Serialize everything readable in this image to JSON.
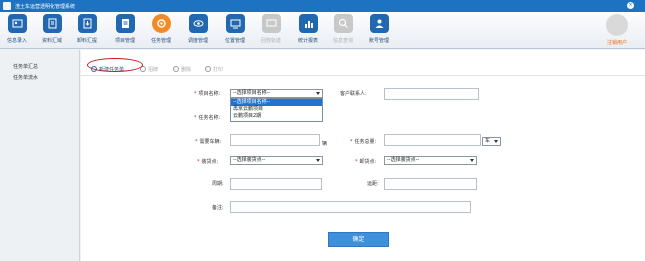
{
  "app": {
    "title": "渣土车运营透明化管理系统",
    "close_symbol": "×"
  },
  "toolbar": {
    "items": [
      {
        "label": "信息录入",
        "icon": "id-card-icon"
      },
      {
        "label": "资料汇域",
        "icon": "pencil-icon"
      },
      {
        "label": "卸料汇提",
        "icon": "download-icon"
      },
      {
        "label": "项目管理",
        "icon": "document-icon"
      },
      {
        "label": "任务管理",
        "icon": "gear-icon"
      },
      {
        "label": "调度管理",
        "icon": "eye-icon"
      },
      {
        "label": "位置管理",
        "icon": "monitor-icon"
      },
      {
        "label": "回放轨迹",
        "icon": "screen-icon"
      },
      {
        "label": "统计报表",
        "icon": "bar-chart-icon"
      },
      {
        "label": "信息查询",
        "icon": "search-icon"
      },
      {
        "label": "账号管理",
        "icon": "user-icon"
      }
    ],
    "logout_label": "注销用户"
  },
  "sidebar": {
    "items": [
      {
        "label": "任务单汇总"
      },
      {
        "label": "任务单流水"
      }
    ]
  },
  "tabs": [
    {
      "label": "新建任务单",
      "selected": true
    },
    {
      "label": "招牌"
    },
    {
      "label": "删除"
    },
    {
      "label": "打印"
    }
  ],
  "form": {
    "project_name": {
      "label": "项目名称:",
      "value": "--选择项目名称--"
    },
    "project_options": [
      "--选择项目名称--",
      "再京云鹏项目",
      "云鹏项目2期"
    ],
    "task_name": {
      "label": "任务名称:"
    },
    "customer_contact": {
      "label": "客户联系人:",
      "value": ""
    },
    "vehicles_needed": {
      "label": "需要车辆:",
      "value": "",
      "unit": "辆"
    },
    "task_total": {
      "label": "任务总量:",
      "value": "",
      "unit_select": "车"
    },
    "loading_point": {
      "label": "装货点:",
      "value": "--选择装货点--"
    },
    "unloading_point": {
      "label": "卸货点:",
      "value": "--选择装货点--"
    },
    "cycle": {
      "label": "周期:",
      "value": ""
    },
    "distance": {
      "label": "运距:",
      "value": ""
    },
    "remark": {
      "label": "备注:",
      "value": ""
    },
    "required_mark": "*"
  },
  "buttons": {
    "confirm_label": "确定"
  },
  "colors": {
    "primary": "#1d73c2",
    "accent": "#f28a27",
    "danger": "#c81e1e",
    "button": "#3e8fdc"
  }
}
